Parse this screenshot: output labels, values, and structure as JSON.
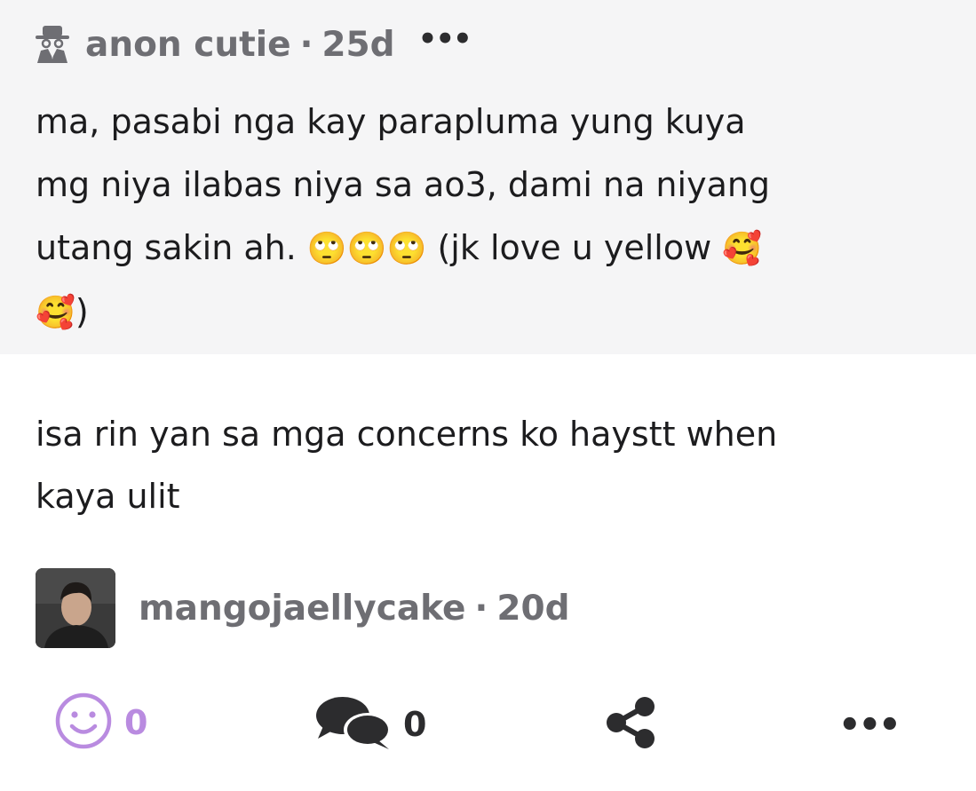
{
  "question": {
    "author": "anon cutie",
    "separator": "·",
    "age": "25d",
    "more": "•••",
    "text_line1": "ma, pasabi nga kay parapluma yung kuya",
    "text_line2": "mg niya ilabas niya sa ao3, dami na niyang",
    "text_line3_a": "utang sakin ah. ",
    "emoji_rolling": "🙄🙄🙄",
    "text_line3_b": " (jk love u yellow ",
    "emoji_love": "🥰",
    "text_line4_b": ")"
  },
  "answer": {
    "text_line1": "isa rin yan sa mga concerns ko haystt when",
    "text_line2": "kaya ulit"
  },
  "author": {
    "username": "mangojaellycake",
    "separator": "·",
    "age": "20d"
  },
  "actions": {
    "react_count": "0",
    "reply_count": "0",
    "more": "•••"
  },
  "colors": {
    "question_bg": "#f5f5f6",
    "meta_gray": "#6e6e73",
    "react_purple": "#b98be0"
  }
}
